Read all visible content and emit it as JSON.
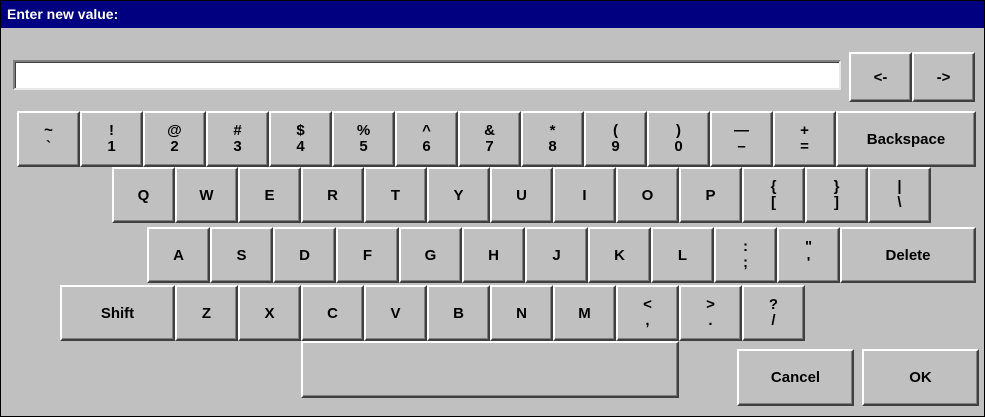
{
  "title": "Enter new value:",
  "input": {
    "value": ""
  },
  "nav": {
    "left": "<-",
    "right": "->"
  },
  "keys": {
    "row1": [
      {
        "upper": "~",
        "lower": "`"
      },
      {
        "upper": "!",
        "lower": "1"
      },
      {
        "upper": "@",
        "lower": "2"
      },
      {
        "upper": "#",
        "lower": "3"
      },
      {
        "upper": "$",
        "lower": "4"
      },
      {
        "upper": "%",
        "lower": "5"
      },
      {
        "upper": "^",
        "lower": "6"
      },
      {
        "upper": "&",
        "lower": "7"
      },
      {
        "upper": "*",
        "lower": "8"
      },
      {
        "upper": "(",
        "lower": "9"
      },
      {
        "upper": ")",
        "lower": "0"
      },
      {
        "upper": "—",
        "lower": "–"
      },
      {
        "upper": "+",
        "lower": "="
      }
    ],
    "backspace": "Backspace",
    "row2": [
      "Q",
      "W",
      "E",
      "R",
      "T",
      "Y",
      "U",
      "I",
      "O",
      "P"
    ],
    "row2_symbols": [
      {
        "upper": "{",
        "lower": "["
      },
      {
        "upper": "}",
        "lower": "]"
      },
      {
        "upper": "|",
        "lower": "\\"
      }
    ],
    "row3": [
      "A",
      "S",
      "D",
      "F",
      "G",
      "H",
      "J",
      "K",
      "L"
    ],
    "row3_symbols": [
      {
        "upper": ":",
        "lower": ";"
      },
      {
        "upper": "\"",
        "lower": "'"
      }
    ],
    "delete": "Delete",
    "shift": "Shift",
    "row4": [
      "Z",
      "X",
      "C",
      "V",
      "B",
      "N",
      "M"
    ],
    "row4_symbols": [
      {
        "upper": "<",
        "lower": ","
      },
      {
        "upper": ">",
        "lower": "."
      },
      {
        "upper": "?",
        "lower": "/"
      }
    ],
    "space": ""
  },
  "actions": {
    "cancel": "Cancel",
    "ok": "OK"
  }
}
